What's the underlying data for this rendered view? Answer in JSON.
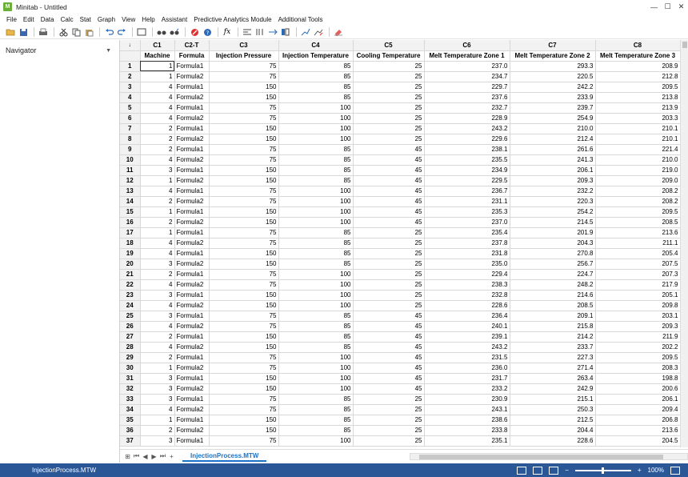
{
  "window": {
    "title": "Minitab - Untitled",
    "app_icon_text": "M",
    "controls": [
      "—",
      "☐",
      "✕"
    ]
  },
  "menu": [
    "File",
    "Edit",
    "Data",
    "Calc",
    "Stat",
    "Graph",
    "View",
    "Help",
    "Assistant",
    "Predictive Analytics Module",
    "Additional Tools"
  ],
  "navigator": {
    "title": "Navigator"
  },
  "worksheet": {
    "corner": "↓",
    "col_ids": [
      "C1",
      "C2-T",
      "C3",
      "C4",
      "C5",
      "C6",
      "C7",
      "C8"
    ],
    "col_names": [
      "Machine",
      "Formula",
      "Injection Pressure",
      "Injection Temperature",
      "Cooling Temperature",
      "Melt Temperature Zone 1",
      "Melt Temperature Zone 2",
      "Melt Temperature Zone 3"
    ],
    "rows": [
      [
        "1",
        "Formula1",
        "75",
        "85",
        "25",
        "237.0",
        "293.3",
        "208.9"
      ],
      [
        "1",
        "Formula2",
        "75",
        "85",
        "25",
        "234.7",
        "220.5",
        "212.8"
      ],
      [
        "4",
        "Formula1",
        "150",
        "85",
        "25",
        "229.7",
        "242.2",
        "209.5"
      ],
      [
        "4",
        "Formula2",
        "150",
        "85",
        "25",
        "237.6",
        "233.9",
        "213.8"
      ],
      [
        "4",
        "Formula1",
        "75",
        "100",
        "25",
        "232.7",
        "239.7",
        "213.9"
      ],
      [
        "4",
        "Formula2",
        "75",
        "100",
        "25",
        "228.9",
        "254.9",
        "203.3"
      ],
      [
        "2",
        "Formula1",
        "150",
        "100",
        "25",
        "243.2",
        "210.0",
        "210.1"
      ],
      [
        "2",
        "Formula2",
        "150",
        "100",
        "25",
        "229.6",
        "212.4",
        "210.1"
      ],
      [
        "2",
        "Formula1",
        "75",
        "85",
        "45",
        "238.1",
        "261.6",
        "221.4"
      ],
      [
        "4",
        "Formula2",
        "75",
        "85",
        "45",
        "235.5",
        "241.3",
        "210.0"
      ],
      [
        "3",
        "Formula1",
        "150",
        "85",
        "45",
        "234.9",
        "206.1",
        "219.0"
      ],
      [
        "1",
        "Formula2",
        "150",
        "85",
        "45",
        "229.5",
        "209.3",
        "209.0"
      ],
      [
        "4",
        "Formula1",
        "75",
        "100",
        "45",
        "236.7",
        "232.2",
        "208.2"
      ],
      [
        "2",
        "Formula2",
        "75",
        "100",
        "45",
        "231.1",
        "220.3",
        "208.2"
      ],
      [
        "1",
        "Formula1",
        "150",
        "100",
        "45",
        "235.3",
        "254.2",
        "209.5"
      ],
      [
        "2",
        "Formula2",
        "150",
        "100",
        "45",
        "237.0",
        "214.5",
        "208.5"
      ],
      [
        "1",
        "Formula1",
        "75",
        "85",
        "25",
        "235.4",
        "201.9",
        "213.6"
      ],
      [
        "4",
        "Formula2",
        "75",
        "85",
        "25",
        "237.8",
        "204.3",
        "211.1"
      ],
      [
        "4",
        "Formula1",
        "150",
        "85",
        "25",
        "231.8",
        "270.8",
        "205.4"
      ],
      [
        "3",
        "Formula2",
        "150",
        "85",
        "25",
        "235.0",
        "256.7",
        "207.5"
      ],
      [
        "2",
        "Formula1",
        "75",
        "100",
        "25",
        "229.4",
        "224.7",
        "207.3"
      ],
      [
        "4",
        "Formula2",
        "75",
        "100",
        "25",
        "238.3",
        "248.2",
        "217.9"
      ],
      [
        "3",
        "Formula1",
        "150",
        "100",
        "25",
        "232.8",
        "214.6",
        "205.1"
      ],
      [
        "4",
        "Formula2",
        "150",
        "100",
        "25",
        "228.6",
        "208.5",
        "209.8"
      ],
      [
        "3",
        "Formula1",
        "75",
        "85",
        "45",
        "236.4",
        "209.1",
        "203.1"
      ],
      [
        "4",
        "Formula2",
        "75",
        "85",
        "45",
        "240.1",
        "215.8",
        "209.3"
      ],
      [
        "2",
        "Formula1",
        "150",
        "85",
        "45",
        "239.1",
        "214.2",
        "211.9"
      ],
      [
        "4",
        "Formula2",
        "150",
        "85",
        "45",
        "243.2",
        "233.7",
        "202.2"
      ],
      [
        "2",
        "Formula1",
        "75",
        "100",
        "45",
        "231.5",
        "227.3",
        "209.5"
      ],
      [
        "1",
        "Formula2",
        "75",
        "100",
        "45",
        "236.0",
        "271.4",
        "208.3"
      ],
      [
        "3",
        "Formula1",
        "150",
        "100",
        "45",
        "231.7",
        "263.4",
        "198.8"
      ],
      [
        "3",
        "Formula2",
        "150",
        "100",
        "45",
        "233.2",
        "242.9",
        "200.6"
      ],
      [
        "3",
        "Formula1",
        "75",
        "85",
        "25",
        "230.9",
        "215.1",
        "206.1"
      ],
      [
        "4",
        "Formula2",
        "75",
        "85",
        "25",
        "243.1",
        "250.3",
        "209.4"
      ],
      [
        "1",
        "Formula1",
        "150",
        "85",
        "25",
        "238.6",
        "212.5",
        "206.8"
      ],
      [
        "2",
        "Formula2",
        "150",
        "85",
        "25",
        "233.8",
        "204.4",
        "213.6"
      ],
      [
        "3",
        "Formula1",
        "75",
        "100",
        "25",
        "235.1",
        "228.6",
        "204.5"
      ]
    ]
  },
  "tabs": {
    "nav_buttons": [
      "⊞",
      "⏮",
      "◀",
      "▶",
      "⏭",
      "+"
    ],
    "sheet_name": "InjectionProcess.MTW"
  },
  "status": {
    "file": "InjectionProcess.MTW",
    "zoom": "100%",
    "minus": "−",
    "plus": "+"
  }
}
